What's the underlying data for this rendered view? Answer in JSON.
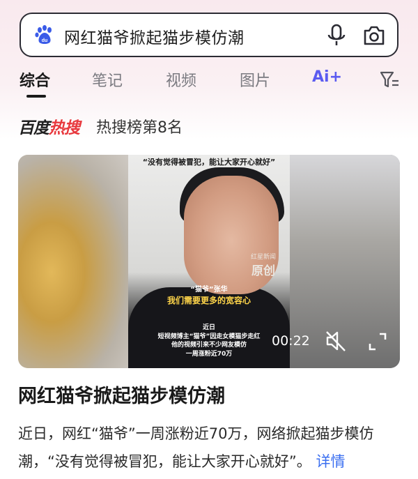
{
  "search": {
    "query": "网红猫爷掀起猫步模仿潮"
  },
  "tabs": [
    {
      "label": "综合",
      "active": true
    },
    {
      "label": "笔记",
      "active": false
    },
    {
      "label": "视频",
      "active": false
    },
    {
      "label": "图片",
      "active": false
    }
  ],
  "ai_tab": {
    "label": "Ai+"
  },
  "hot": {
    "logo_black": "百度",
    "logo_red": "热搜",
    "rank_text": "热搜榜第8名"
  },
  "video": {
    "caption_top": "“没有觉得被冒犯，能让大家开心就好”",
    "watermark_small": "红星新闻",
    "watermark_big": "原创",
    "speaker_label": "“猫爷”张华",
    "subtitle": "我们需要更多的宽容心",
    "caption_bottom": [
      "近日",
      "短视频博主“猫爷”因走女模猫步走红",
      "他的视频引来不少网友模仿",
      "一周涨粉近70万"
    ],
    "duration": "00:22"
  },
  "article": {
    "title": "网红猫爷掀起猫步模仿潮",
    "body": "近日，网红“猫爷”一周涨粉近70万，网络掀起猫步模仿潮，“没有觉得被冒犯，能让大家开心就好”。",
    "more_label": "详情"
  },
  "colors": {
    "accent_blue": "#3b6ff0",
    "hot_red": "#e8383d",
    "ai_purple": "#5b5bf0"
  }
}
